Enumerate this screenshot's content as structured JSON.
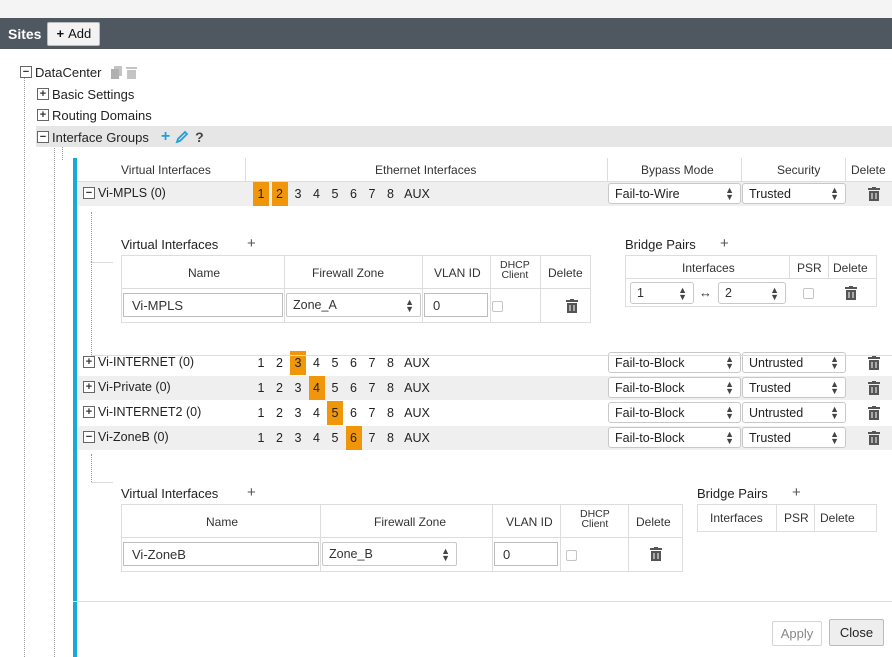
{
  "sites": {
    "title": "Sites",
    "add_label": "Add"
  },
  "tree": {
    "root": "DataCenter",
    "basic_settings": "Basic Settings",
    "routing_domains": "Routing Domains",
    "interface_groups": "Interface Groups",
    "help": "?"
  },
  "table_headers": {
    "virtual_interfaces": "Virtual Interfaces",
    "ethernet_interfaces": "Ethernet Interfaces",
    "bypass_mode": "Bypass Mode",
    "security": "Security",
    "delete": "Delete"
  },
  "eth_labels": [
    "1",
    "2",
    "3",
    "4",
    "5",
    "6",
    "7",
    "8",
    "AUX"
  ],
  "rows": [
    {
      "name": "Vi-MPLS (0)",
      "expanded": true,
      "active_ports": [
        "1",
        "2"
      ],
      "bypass": "Fail-to-Wire",
      "security": "Trusted"
    },
    {
      "name": "Vi-INTERNET (0)",
      "expanded": false,
      "active_ports": [
        "3"
      ],
      "bypass": "Fail-to-Block",
      "security": "Untrusted"
    },
    {
      "name": "Vi-Private (0)",
      "expanded": false,
      "active_ports": [
        "4"
      ],
      "bypass": "Fail-to-Block",
      "security": "Trusted"
    },
    {
      "name": "Vi-INTERNET2 (0)",
      "expanded": false,
      "active_ports": [
        "5"
      ],
      "bypass": "Fail-to-Block",
      "security": "Untrusted"
    },
    {
      "name": "Vi-ZoneB (0)",
      "expanded": true,
      "active_ports": [
        "6"
      ],
      "bypass": "Fail-to-Block",
      "security": "Trusted"
    }
  ],
  "detail_labels": {
    "virtual_interfaces": "Virtual Interfaces",
    "bridge_pairs": "Bridge Pairs",
    "name": "Name",
    "firewall_zone": "Firewall Zone",
    "vlan_id": "VLAN ID",
    "dhcp_client_1": "DHCP",
    "dhcp_client_2": "Client",
    "delete": "Delete",
    "interfaces": "Interfaces",
    "psr": "PSR",
    "arrow": "↔",
    "plus": "+"
  },
  "detail_mpls": {
    "name": "Vi-MPLS",
    "zone": "Zone_A",
    "vlan": "0",
    "bridge_left": "1",
    "bridge_right": "2"
  },
  "detail_zoneb": {
    "name": "Vi-ZoneB",
    "zone": "Zone_B",
    "vlan": "0"
  },
  "footer": {
    "apply": "Apply",
    "close": "Close"
  },
  "colors": {
    "header_bar": "#4f5760",
    "active_port": "#f0960a",
    "accent": "#19a9d8"
  }
}
